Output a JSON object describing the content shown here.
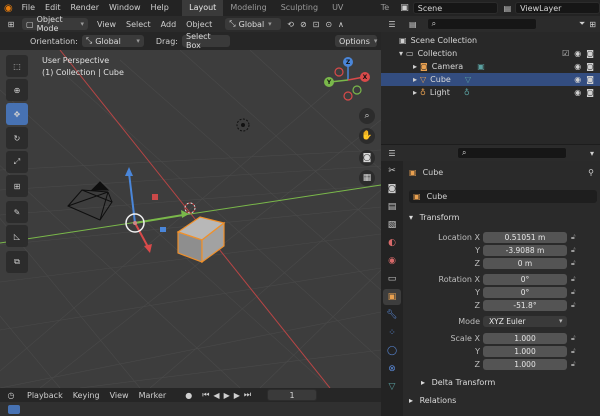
{
  "topbar": {
    "menus": [
      "File",
      "Edit",
      "Render",
      "Window",
      "Help"
    ],
    "workspace_tabs": [
      "Layout",
      "Modeling",
      "Sculpting",
      "UV Editing",
      "Te"
    ],
    "active_tab": "Layout",
    "scene": "Scene",
    "view_layer": "ViewLayer"
  },
  "viewport_header": {
    "mode": "Object Mode",
    "menus": [
      "View",
      "Select",
      "Add",
      "Object"
    ],
    "transform_orientation": "Global"
  },
  "viewport_header2": {
    "orientation_label": "Orientation:",
    "orientation_value": "Global",
    "drag_label": "Drag:",
    "drag_value": "Select Box",
    "options": "Options"
  },
  "viewport": {
    "view_name": "User Perspective",
    "collection_info": "(1) Collection | Cube",
    "gizmo_axes": [
      "X",
      "Y",
      "Z"
    ]
  },
  "timeline": {
    "menus": [
      "Playback",
      "Keying",
      "View",
      "Marker"
    ],
    "current_frame": "1"
  },
  "outliner": {
    "root": "Scene Collection",
    "items": [
      {
        "label": "Collection",
        "indent": 1
      },
      {
        "label": "Camera",
        "indent": 2
      },
      {
        "label": "Cube",
        "indent": 2,
        "selected": true
      },
      {
        "label": "Light",
        "indent": 2
      }
    ]
  },
  "properties": {
    "object_name": "Cube",
    "object_field": "Cube",
    "transform_section": "Transform",
    "location_label": "Location X",
    "location": [
      "0.51051 m",
      "-3.9088 m",
      "0 m"
    ],
    "rotation_label": "Rotation X",
    "rotation": [
      "0°",
      "0°",
      "-51.8°"
    ],
    "mode_label": "Mode",
    "mode_value": "XYZ Euler",
    "scale_label": "Scale X",
    "scale": [
      "1.000",
      "1.000",
      "1.000"
    ],
    "axis_y": "Y",
    "axis_z": "Z",
    "delta_transform": "Delta Transform",
    "relations": "Relations"
  },
  "colors": {
    "accent": "#4772b3",
    "selection": "#334d80",
    "axis_x": "#d94a4a",
    "axis_y": "#7ab84a",
    "axis_z": "#4a86d9",
    "selected_outline": "#f0902a"
  }
}
